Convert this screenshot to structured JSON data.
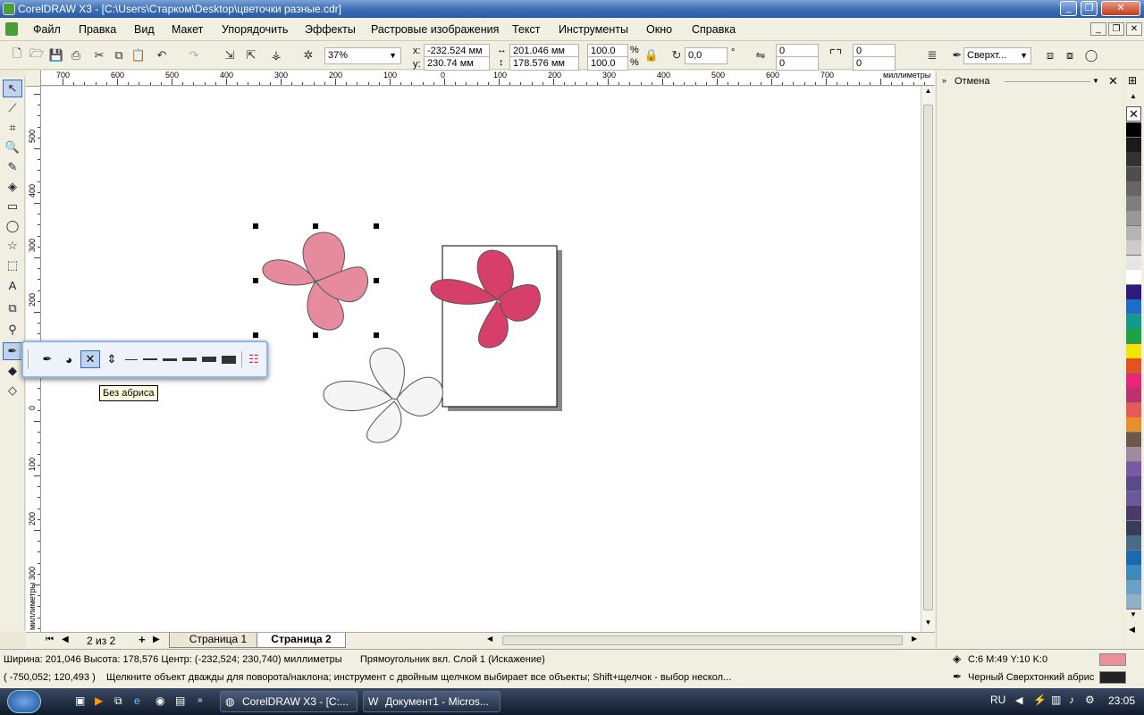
{
  "title": "CorelDRAW X3 - [C:\\Users\\Старком\\Desktop\\цветочки разные.cdr]",
  "menu": [
    "Файл",
    "Правка",
    "Вид",
    "Макет",
    "Упорядочить",
    "Эффекты",
    "Растровые изображения",
    "Текст",
    "Инструменты",
    "Окно",
    "Справка"
  ],
  "propbar": {
    "zoom": "37%",
    "x_label": "x:",
    "x": "-232.524 мм",
    "y_label": "y:",
    "y": "230.74 мм",
    "width": "201.046 мм",
    "height": "178.576 мм",
    "scale_x": "100.0",
    "scale_y": "100.0",
    "percent": "%",
    "angle": "0,0",
    "degree": "°",
    "corner_a1": "0",
    "corner_a2": "0",
    "corner_b1": "0",
    "corner_b2": "0",
    "outline_width": "Сверхт..."
  },
  "ruler": {
    "h_labels": [
      "700",
      "600",
      "500",
      "400",
      "300",
      "200",
      "100",
      "0",
      "100",
      "200",
      "300",
      "400",
      "500",
      "600",
      "700",
      "миллиметры"
    ],
    "v_labels": [
      "500",
      "400",
      "300",
      "200",
      "100",
      "0",
      "100",
      "200",
      "300",
      "миллиметры"
    ]
  },
  "docker": {
    "title": "Отмена"
  },
  "pages": {
    "counter": "2 из 2",
    "tab1": "Страница 1",
    "tab2": "Страница 2"
  },
  "flyout": {
    "tooltip": "Без абриса"
  },
  "status": {
    "line1": "Ширина: 201,046  Высота: 178,576  Центр: (-232,524; 230,740)  миллиметры",
    "line1b": "Прямоугольник вкл. Слой 1  (Искажение)",
    "line2": "( -750,052; 120,493 )",
    "hint": "Щелкните объект дважды для поворота/наклона; инструмент с двойным щелчком выбирает все объекты; Shift+щелчок - выбор нескол...",
    "fill_info": "C:6 M:49 Y:10 K:0",
    "outline_info": "Черный  Сверхтонкий абрис",
    "fill_color": "#e8909e",
    "outline_color": "#222222"
  },
  "taskbar": {
    "task1": "CorelDRAW X3 - [C:...",
    "task2": "Документ1 - Micros...",
    "lang": "RU",
    "time": "23:05"
  },
  "colors": {
    "pink_light": "#e68a9e",
    "pink_dark": "#d63f6a",
    "white_flower": "#f5f5f5"
  },
  "palette": [
    "#000000",
    "#1a1a1a",
    "#333333",
    "#4d4d4d",
    "#666666",
    "#7f7f7f",
    "#999999",
    "#b3b3b3",
    "#cccccc",
    "#e5e5e5",
    "#ffffff",
    "#2e1a7a",
    "#1a6ec9",
    "#0f9c8a",
    "#1ba34a",
    "#f2e600",
    "#e8501e",
    "#e8257a",
    "#c0306a",
    "#e85a5a",
    "#e8902a",
    "#6b5a4a",
    "#a08aa0",
    "#7a5aa8",
    "#5a4a8a",
    "#6a5a9a",
    "#4a3a6a",
    "#3a3a5a",
    "#4a6a8a",
    "#1a6ab0",
    "#3a8ac0",
    "#6aa0c8",
    "#90b0c8"
  ]
}
